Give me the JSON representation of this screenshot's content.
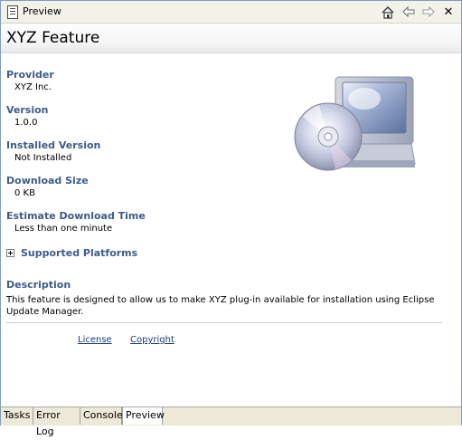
{
  "window": {
    "title": "Preview",
    "toolbar": {
      "home_icon": "home-icon",
      "back_icon": "back-arrow-icon",
      "forward_icon": "forward-arrow-icon",
      "close_label": "✕"
    }
  },
  "feature": {
    "title": "XYZ Feature",
    "provider_label": "Provider",
    "provider_value": "XYZ Inc.",
    "version_label": "Version",
    "version_value": "1.0.0",
    "installed_version_label": "Installed Version",
    "installed_version_value": "Not Installed",
    "download_size_label": "Download Size",
    "download_size_value": "0 KB",
    "estimate_label": "Estimate Download Time",
    "estimate_value": "Less than one minute",
    "supported_platforms_label": "Supported Platforms",
    "description_label": "Description",
    "description_text": "This feature is designed to allow us to make XYZ plug-in available for installation using Eclipse Update Manager.",
    "license_link": "License",
    "copyright_link": "Copyright"
  },
  "tabs": [
    {
      "label": "Tasks",
      "active": false
    },
    {
      "label": "Error Log",
      "active": false
    },
    {
      "label": "Console",
      "active": false
    },
    {
      "label": "Preview",
      "active": true
    }
  ],
  "colors": {
    "label_blue": "#3d5c8a",
    "link_blue": "#1a3a7a",
    "titlebar_bg": "#f2f1ea"
  }
}
